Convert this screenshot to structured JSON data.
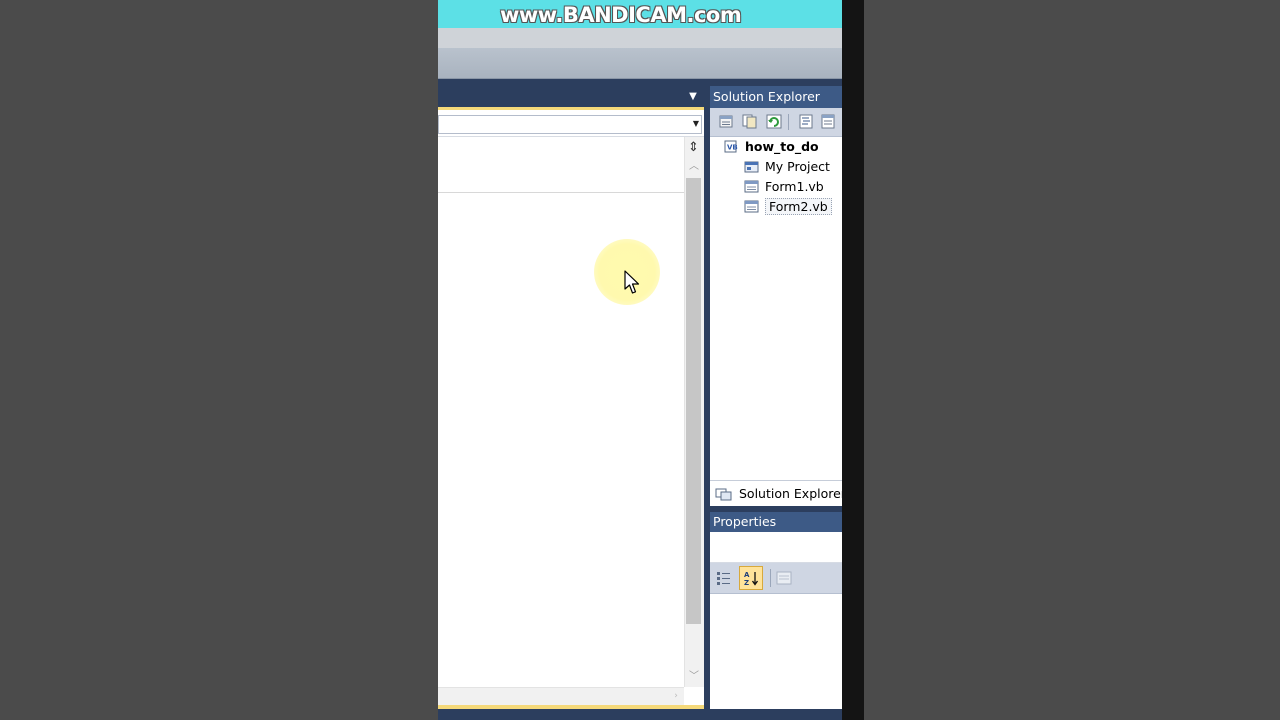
{
  "watermark": {
    "text": "www.BANDICAM.com"
  },
  "editor": {
    "tab_dropdown_icon": "chevron-down-icon",
    "combo_value": "",
    "split_icon": "split-editor-icon"
  },
  "solution_explorer": {
    "title": "Solution Explorer",
    "toolbar_icons": [
      "properties-icon",
      "show-all-files-icon",
      "refresh-icon",
      "view-code-icon",
      "view-designer-icon"
    ],
    "tree": [
      {
        "label": "how_to_do",
        "icon": "vb-project-icon",
        "bold": true
      },
      {
        "label": "My Project",
        "icon": "my-project-icon"
      },
      {
        "label": "Form1.vb",
        "icon": "form-icon"
      },
      {
        "label": "Form2.vb",
        "icon": "form-icon",
        "selected": true
      }
    ],
    "footer_label": "Solution Explorer"
  },
  "properties": {
    "title": "Properties",
    "toolbar_icons": [
      "categorized-icon",
      "alphabetical-icon",
      "property-pages-icon"
    ]
  },
  "colors": {
    "ide_frame": "#2c3e5e",
    "panel_title": "#3d5a86",
    "active_tab_accent": "#f5d97a",
    "watermark_bar": "#5ce0e6"
  }
}
